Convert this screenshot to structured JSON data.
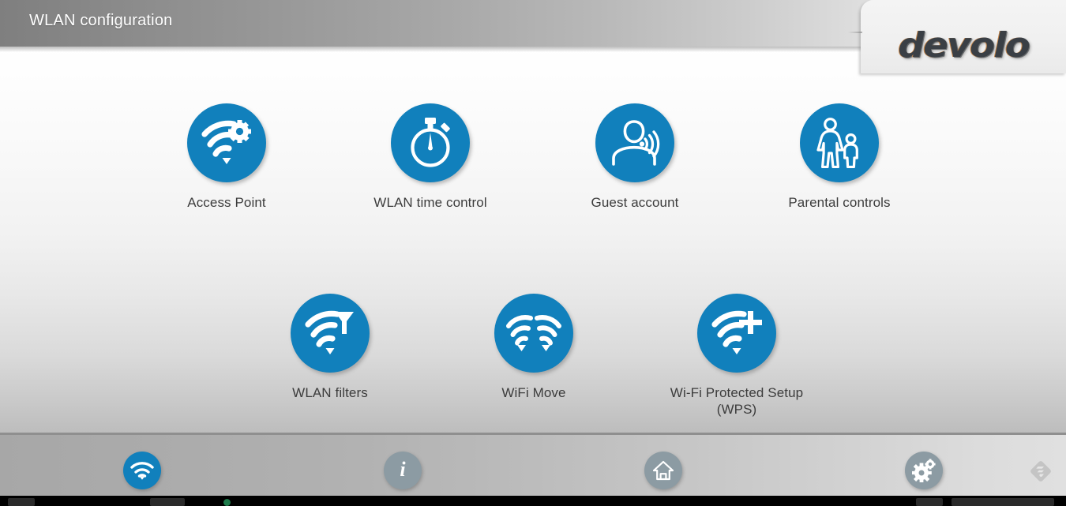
{
  "window": {
    "title": "WLAN configuration",
    "brand": "devolo"
  },
  "theme": {
    "accent_blue": "#1180bc",
    "footer_inactive": "#8c9ba3",
    "label_text": "#3c3c3c",
    "header_title_text": "#ffffff"
  },
  "tiles": [
    {
      "id": "access-point",
      "label": "Access Point",
      "icon": "wifi-gear-icon",
      "row": 1,
      "col": 1
    },
    {
      "id": "wlan-time-control",
      "label": "WLAN time control",
      "icon": "stopwatch-icon",
      "row": 1,
      "col": 2
    },
    {
      "id": "guest-account",
      "label": "Guest account",
      "icon": "user-wifi-icon",
      "row": 1,
      "col": 3
    },
    {
      "id": "parental-controls",
      "label": "Parental controls",
      "icon": "parent-child-icon",
      "row": 1,
      "col": 4
    },
    {
      "id": "wlan-filters",
      "label": "WLAN filters",
      "icon": "wifi-filter-icon",
      "row": 2,
      "col": 1
    },
    {
      "id": "wifi-move",
      "label": "WiFi Move",
      "icon": "double-wifi-icon",
      "row": 2,
      "col": 2
    },
    {
      "id": "wps",
      "label": "Wi-Fi Protected Setup (WPS)",
      "icon": "wifi-plus-icon",
      "row": 2,
      "col": 3
    }
  ],
  "footer": {
    "items": [
      {
        "id": "wlan",
        "icon": "wifi-icon",
        "state": "active"
      },
      {
        "id": "info",
        "icon": "info-icon",
        "state": "inactive"
      },
      {
        "id": "home",
        "icon": "home-icon",
        "state": "inactive"
      },
      {
        "id": "settings",
        "icon": "gears-icon",
        "state": "inactive"
      },
      {
        "id": "logout",
        "icon": "diamond-icon",
        "state": "flat"
      }
    ]
  }
}
